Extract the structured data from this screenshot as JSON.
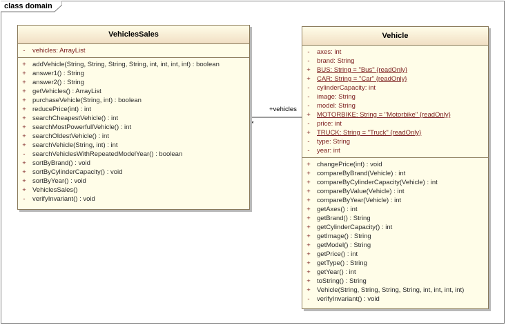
{
  "frame": {
    "title": "class domain"
  },
  "classes": [
    {
      "name": "VehiclesSales",
      "attributes": [
        {
          "vis": "-",
          "text": "vehicles:  ArrayList",
          "static": false
        }
      ],
      "operations": [
        {
          "vis": "+",
          "text": "addVehicle(String, String, String, String, int, int, int, int) : boolean"
        },
        {
          "vis": "+",
          "text": "answer1() : String"
        },
        {
          "vis": "+",
          "text": "answer2() : String"
        },
        {
          "vis": "+",
          "text": "getVehicles() : ArrayList"
        },
        {
          "vis": "+",
          "text": "purchaseVehicle(String, int) : boolean"
        },
        {
          "vis": "+",
          "text": "reducePrice(int) : int"
        },
        {
          "vis": "+",
          "text": "searchCheapestVehicle() : int"
        },
        {
          "vis": "+",
          "text": "searchMostPowerfullVehicle() : int"
        },
        {
          "vis": "+",
          "text": "searchOldestVehicle() : int"
        },
        {
          "vis": "+",
          "text": "searchVehicle(String, int) : int"
        },
        {
          "vis": "-",
          "text": "searchVehiclesWithRepeatedModelYear() : boolean"
        },
        {
          "vis": "+",
          "text": "sortByBrand() : void"
        },
        {
          "vis": "+",
          "text": "sortByCylinderCapacity() : void"
        },
        {
          "vis": "+",
          "text": "sortByYear() : void"
        },
        {
          "vis": "+",
          "text": "VehiclesSales()"
        },
        {
          "vis": "-",
          "text": "verifyInvariant() : void"
        }
      ]
    },
    {
      "name": "Vehicle",
      "attributes": [
        {
          "vis": "-",
          "text": "axes:  int",
          "static": false
        },
        {
          "vis": "-",
          "text": "brand:  String",
          "static": false
        },
        {
          "vis": "+",
          "text": "BUS:  String = \"Bus\" {readOnly}",
          "static": true
        },
        {
          "vis": "+",
          "text": "CAR:  String = \"Car\" {readOnly}",
          "static": true
        },
        {
          "vis": "-",
          "text": "cylinderCapacity:  int",
          "static": false
        },
        {
          "vis": "-",
          "text": "image:  String",
          "static": false
        },
        {
          "vis": "-",
          "text": "model:  String",
          "static": false
        },
        {
          "vis": "+",
          "text": "MOTORBIKE:  String = \"Motorbike\" {readOnly}",
          "static": true
        },
        {
          "vis": "-",
          "text": "price:  int",
          "static": false
        },
        {
          "vis": "+",
          "text": "TRUCK:  String = \"Truck\" {readOnly}",
          "static": true
        },
        {
          "vis": "-",
          "text": "type:  String",
          "static": false
        },
        {
          "vis": "-",
          "text": "year:  int",
          "static": false
        }
      ],
      "operations": [
        {
          "vis": "+",
          "text": "changePrice(int) : void"
        },
        {
          "vis": "+",
          "text": "compareByBrand(Vehicle) : int"
        },
        {
          "vis": "+",
          "text": "compareByCylinderCapacity(Vehicle) : int"
        },
        {
          "vis": "+",
          "text": "compareByValue(Vehicle) : int"
        },
        {
          "vis": "+",
          "text": "compareByYear(Vehicle) : int"
        },
        {
          "vis": "+",
          "text": "getAxes() : int"
        },
        {
          "vis": "+",
          "text": "getBrand() : String"
        },
        {
          "vis": "+",
          "text": "getCylinderCapacity() : int"
        },
        {
          "vis": "+",
          "text": "getImage() : String"
        },
        {
          "vis": "+",
          "text": "getModel() : String"
        },
        {
          "vis": "+",
          "text": "getPrice() : int"
        },
        {
          "vis": "+",
          "text": "getType() : String"
        },
        {
          "vis": "+",
          "text": "getYear() : int"
        },
        {
          "vis": "+",
          "text": "toString() : String"
        },
        {
          "vis": "+",
          "text": "Vehicle(String, String, String, String, int, int, int, int)"
        },
        {
          "vis": "-",
          "text": "verifyInvariant() : void"
        }
      ]
    }
  ],
  "association": {
    "role": "+vehicles",
    "multiplicity": "*"
  }
}
